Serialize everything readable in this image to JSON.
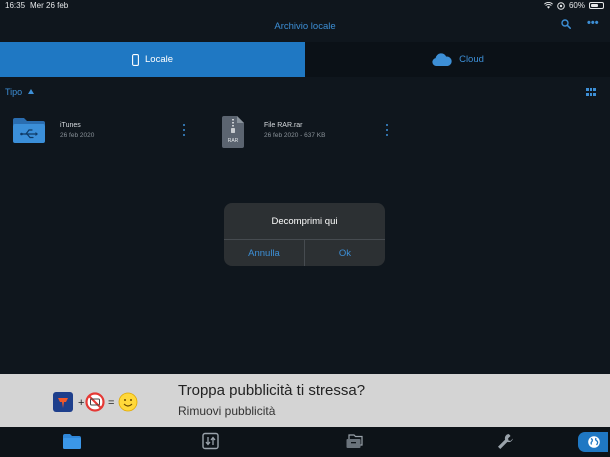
{
  "status": {
    "time": "16:35",
    "date": "Mer 26 feb",
    "battery": "60%",
    "battery_level": 0.6
  },
  "nav": {
    "title": "Archivio locale",
    "search_icon": "search-icon",
    "more_icon": "more-icon",
    "more_glyph": "•••"
  },
  "segments": {
    "locale": "Locale",
    "cloud": "Cloud"
  },
  "sort": {
    "label": "Tipo"
  },
  "files": [
    {
      "name": "iTunes",
      "meta": "26 feb 2020",
      "icon": "folder-usb-icon"
    },
    {
      "name": "File RAR.rar",
      "meta": "26 feb 2020 - 637 KB",
      "icon": "archive-icon",
      "icon_label": "RAR"
    }
  ],
  "dialog": {
    "title": "Decomprimi qui",
    "cancel": "Annulla",
    "ok": "Ok"
  },
  "ad": {
    "title": "Troppa pubblicità ti stressa?",
    "subtitle": "Rimuovi pubblicità"
  },
  "colors": {
    "background": "#0f161d",
    "accent": "#1f78c3",
    "link": "#3d8fd6",
    "dialog": "#2c3033",
    "ad_background": "#d4d4d4"
  }
}
